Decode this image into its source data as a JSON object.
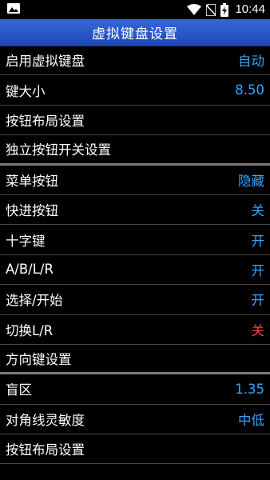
{
  "status_bar": {
    "time": "10:44",
    "icons": [
      "image-icon",
      "wifi-icon",
      "no-sim-icon",
      "battery-charging-icon"
    ]
  },
  "title": "虚拟键盘设置",
  "colors": {
    "accent_value": "#33a4ff",
    "off_value": "#ff3b3b",
    "title_bar": "#2a59c8"
  },
  "rows": [
    {
      "label": "启用虚拟键盘",
      "value": "自动"
    },
    {
      "label": "键大小",
      "value": "8.50"
    },
    {
      "label": "按钮布局设置",
      "value": ""
    },
    {
      "label": "独立按钮开关设置",
      "value": ""
    },
    {
      "label": "菜单按钮",
      "value": "隐藏"
    },
    {
      "label": "快进按钮",
      "value": "关"
    },
    {
      "label": "十字键",
      "value": "开"
    },
    {
      "label": "A/B/L/R",
      "value": "开"
    },
    {
      "label": "选择/开始",
      "value": "开"
    },
    {
      "label": "切换L/R",
      "value": "关"
    },
    {
      "label": "方向键设置",
      "value": ""
    },
    {
      "label": "盲区",
      "value": "1.35"
    },
    {
      "label": "对角线灵敏度",
      "value": "中低"
    },
    {
      "label": "按钮布局设置",
      "value": ""
    }
  ]
}
